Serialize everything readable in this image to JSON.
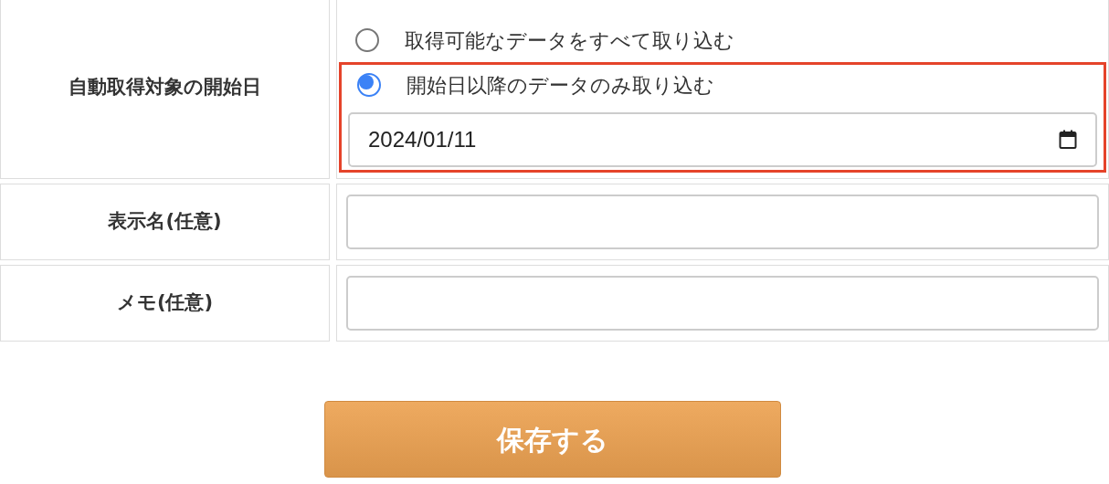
{
  "rows": [
    {
      "label": "自動取得対象の開始日",
      "kind": "import",
      "options": [
        {
          "label": "取得可能なデータをすべて取り込む",
          "selected": false
        },
        {
          "label": "開始日以降のデータのみ取り込む",
          "selected": true
        }
      ],
      "date_field": {
        "value": "2024/01/11"
      },
      "highlighted": true
    },
    {
      "label": "表示名(任意)",
      "kind": "text"
    },
    {
      "label": "メモ(任意)",
      "kind": "text"
    }
  ],
  "save_button": "保存する"
}
